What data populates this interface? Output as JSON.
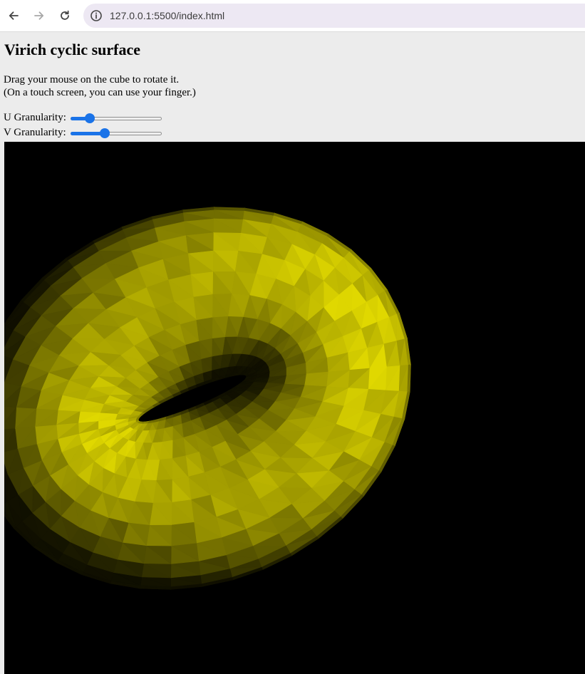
{
  "browser": {
    "url": "127.0.0.1:5500/index.html",
    "back_icon": "arrow-left-icon",
    "forward_icon": "arrow-right-icon",
    "reload_icon": "reload-icon",
    "info_icon": "info-icon"
  },
  "page": {
    "title": "Virich cyclic surface",
    "instruction_line1": "Drag your mouse on the cube to rotate it.",
    "instruction_line2": "(On a touch screen, you can use your finger.)"
  },
  "controls": {
    "u": {
      "label": "U Granularity:",
      "value_fraction": 0.18
    },
    "v": {
      "label": "V Granularity:",
      "value_fraction": 0.36
    }
  },
  "colors": {
    "slider_accent": "#1a73e8",
    "surface_base": "#e0d800",
    "canvas_background": "#000000"
  }
}
